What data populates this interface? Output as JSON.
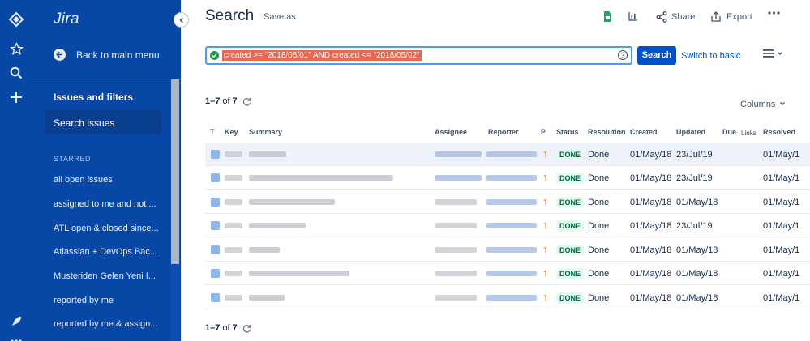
{
  "app": {
    "name": "Jira"
  },
  "rail": {
    "icons": [
      "jira-logo-icon",
      "star-icon",
      "search-icon",
      "plus-icon",
      "rocket-icon",
      "more-icon"
    ]
  },
  "sidebar": {
    "back_label": "Back to main menu",
    "section_title": "Issues and filters",
    "active_item": "Search issues",
    "starred_heading": "STARRED",
    "starred": [
      "all open issues",
      "assigned to me and not ...",
      "ATL open & closed since...",
      "Atlassian + DevOps Bac...",
      "Musteriden Gelen Yeni I...",
      "reported by me",
      "reported by me & assign..."
    ]
  },
  "header": {
    "title": "Search",
    "save_as": "Save as",
    "share": "Share",
    "export": "Export"
  },
  "query": {
    "text": "created >= \"2018/05/01\" AND created <= \"2018/05/02\"",
    "search_button": "Search",
    "switch_label": "Switch to basic"
  },
  "results": {
    "range": "1–7",
    "of": "of",
    "total": "7",
    "columns_label": "Columns"
  },
  "table": {
    "headers": [
      "T",
      "Key",
      "Summary",
      "Assignee",
      "Reporter",
      "P",
      "Status",
      "Resolution",
      "Created",
      "Updated",
      "Due",
      "Links",
      "Resolved"
    ],
    "rows": [
      {
        "status": "DONE",
        "resolution": "Done",
        "created": "01/May/18",
        "updated": "23/Jul/19",
        "resolved": "01/May/1"
      },
      {
        "status": "DONE",
        "resolution": "Done",
        "created": "01/May/18",
        "updated": "23/Jul/19",
        "resolved": "01/May/1"
      },
      {
        "status": "DONE",
        "resolution": "Done",
        "created": "01/May/18",
        "updated": "01/May/18",
        "resolved": "01/May/1"
      },
      {
        "status": "DONE",
        "resolution": "Done",
        "created": "01/May/18",
        "updated": "23/Jul/19",
        "resolved": "01/May/1"
      },
      {
        "status": "DONE",
        "resolution": "Done",
        "created": "01/May/18",
        "updated": "01/May/18",
        "resolved": "01/May/1"
      },
      {
        "status": "DONE",
        "resolution": "Done",
        "created": "01/May/18",
        "updated": "01/May/18",
        "resolved": "01/May/1"
      },
      {
        "status": "DONE",
        "resolution": "Done",
        "created": "01/May/18",
        "updated": "01/May/18",
        "resolved": "01/May/1"
      }
    ]
  },
  "colors": {
    "sidebar": "#0747a6",
    "primary": "#0052cc",
    "done_bg": "#e3fcef",
    "done_fg": "#006644",
    "priority": "#f07a2f",
    "query_highlight": "#e9674f"
  }
}
